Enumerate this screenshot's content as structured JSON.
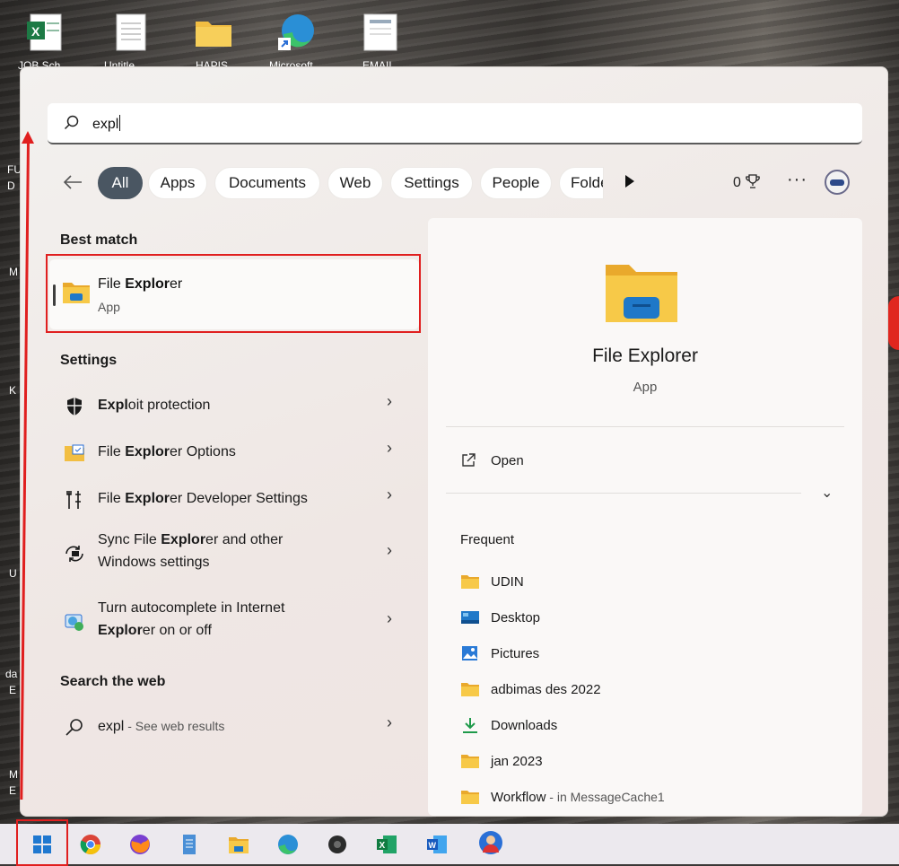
{
  "desktop": {
    "icon_labels": [
      "JOB Sch",
      "Untitle",
      "HAPIS",
      "Microsoft",
      "EMAIL"
    ],
    "side_fragments": [
      "FU",
      "D",
      "M",
      "K",
      "U",
      "da",
      "E",
      "M",
      "E"
    ]
  },
  "search": {
    "query": "expl"
  },
  "filters": {
    "tabs": [
      "All",
      "Apps",
      "Documents",
      "Web",
      "Settings",
      "People",
      "Folde"
    ],
    "points": "0",
    "more": "···"
  },
  "best_match": {
    "heading": "Best match",
    "name_pre": "File ",
    "name_bold": "Explor",
    "name_post": "er",
    "type": "App"
  },
  "settings": {
    "heading": "Settings",
    "items": [
      {
        "pre": "",
        "bold": "Expl",
        "post": "oit protection"
      },
      {
        "pre": "File ",
        "bold": "Explor",
        "post": "er Options"
      },
      {
        "pre": "File ",
        "bold": "Explor",
        "post": "er Developer Settings"
      },
      {
        "pre": "Sync File ",
        "bold": "Explor",
        "post": "er and other",
        "line2": "Windows settings"
      },
      {
        "pre": "Turn autocomplete in Internet",
        "bold": "Explor",
        "post": "er on or off"
      }
    ]
  },
  "web": {
    "heading": "Search the web",
    "query": "expl",
    "suffix": " - See web results"
  },
  "preview": {
    "name": "File Explorer",
    "type": "App",
    "open_label": "Open",
    "frequent_heading": "Frequent",
    "frequent": [
      {
        "icon": "folder-icon",
        "name": "UDIN",
        "suffix": ""
      },
      {
        "icon": "desktop-icon",
        "name": "Desktop",
        "suffix": ""
      },
      {
        "icon": "pictures-icon",
        "name": "Pictures",
        "suffix": ""
      },
      {
        "icon": "folder-icon",
        "name": "adbimas des 2022",
        "suffix": ""
      },
      {
        "icon": "downloads-icon",
        "name": "Downloads",
        "suffix": ""
      },
      {
        "icon": "folder-icon",
        "name": "jan 2023",
        "suffix": ""
      },
      {
        "icon": "folder-icon",
        "name": "Workflow",
        "suffix": " - in MessageCache1"
      }
    ]
  },
  "colors": {
    "annotation_red": "#e01f1f",
    "active_pill": "#4a5662",
    "folder_yellow": "#f7c948"
  }
}
